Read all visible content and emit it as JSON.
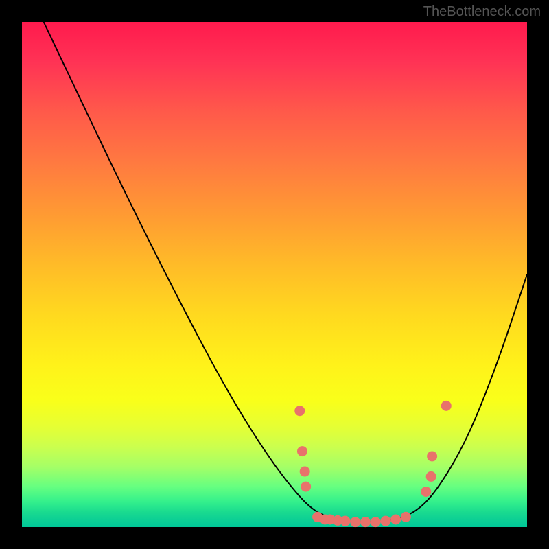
{
  "watermark": "TheBottleneck.com",
  "chart_data": {
    "type": "line",
    "title": "",
    "xlabel": "",
    "ylabel": "",
    "xlim": [
      0,
      100
    ],
    "ylim": [
      0,
      100
    ],
    "curve": [
      {
        "x": 4.3,
        "y": 100
      },
      {
        "x": 10,
        "y": 88
      },
      {
        "x": 20,
        "y": 67
      },
      {
        "x": 30,
        "y": 47
      },
      {
        "x": 40,
        "y": 28
      },
      {
        "x": 48,
        "y": 15
      },
      {
        "x": 54,
        "y": 7
      },
      {
        "x": 58,
        "y": 3
      },
      {
        "x": 62,
        "y": 1.5
      },
      {
        "x": 66,
        "y": 1
      },
      {
        "x": 70,
        "y": 1
      },
      {
        "x": 74,
        "y": 1.5
      },
      {
        "x": 78,
        "y": 3
      },
      {
        "x": 82,
        "y": 7
      },
      {
        "x": 88,
        "y": 17
      },
      {
        "x": 94,
        "y": 32
      },
      {
        "x": 100,
        "y": 50
      }
    ],
    "marker_points": [
      {
        "x": 55,
        "y": 23
      },
      {
        "x": 55.5,
        "y": 15
      },
      {
        "x": 56,
        "y": 11
      },
      {
        "x": 56.2,
        "y": 8
      },
      {
        "x": 58.5,
        "y": 2
      },
      {
        "x": 60,
        "y": 1.5
      },
      {
        "x": 61,
        "y": 1.5
      },
      {
        "x": 62.5,
        "y": 1.3
      },
      {
        "x": 64,
        "y": 1.2
      },
      {
        "x": 66,
        "y": 1
      },
      {
        "x": 68,
        "y": 1
      },
      {
        "x": 70,
        "y": 1
      },
      {
        "x": 72,
        "y": 1.2
      },
      {
        "x": 74,
        "y": 1.5
      },
      {
        "x": 76,
        "y": 2
      },
      {
        "x": 80,
        "y": 7
      },
      {
        "x": 81,
        "y": 10
      },
      {
        "x": 81.2,
        "y": 14
      },
      {
        "x": 84,
        "y": 24
      }
    ],
    "marker_color": "#e8726b",
    "marker_radius": 7,
    "gradient_stops": [
      {
        "pos": 0,
        "color": "#ff1a4d"
      },
      {
        "pos": 50,
        "color": "#ffd91f"
      },
      {
        "pos": 80,
        "color": "#e6ff33"
      },
      {
        "pos": 100,
        "color": "#00c898"
      }
    ]
  }
}
